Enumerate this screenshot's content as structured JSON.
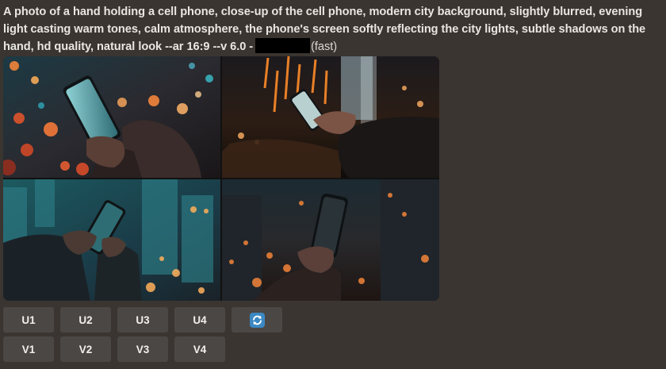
{
  "prompt": {
    "text": "A photo of a hand holding a cell phone, close-up of the cell phone, modern city background, slightly blurred, evening light casting warm tones, calm atmosphere, the phone's screen softly reflecting the city lights, subtle shadows on the hand, hd quality, natural look --ar 16:9 --v 6.0 -",
    "mode": "(fast)"
  },
  "images": [
    {
      "label": "image-1"
    },
    {
      "label": "image-2"
    },
    {
      "label": "image-3"
    },
    {
      "label": "image-4"
    }
  ],
  "buttons": {
    "upscale": [
      "U1",
      "U2",
      "U3",
      "U4"
    ],
    "variation": [
      "V1",
      "V2",
      "V3",
      "V4"
    ],
    "reroll_icon": "refresh-icon"
  },
  "colors": {
    "background": "#3a3530",
    "button": "#4b4744",
    "reroll_icon": "#3b88c3"
  }
}
